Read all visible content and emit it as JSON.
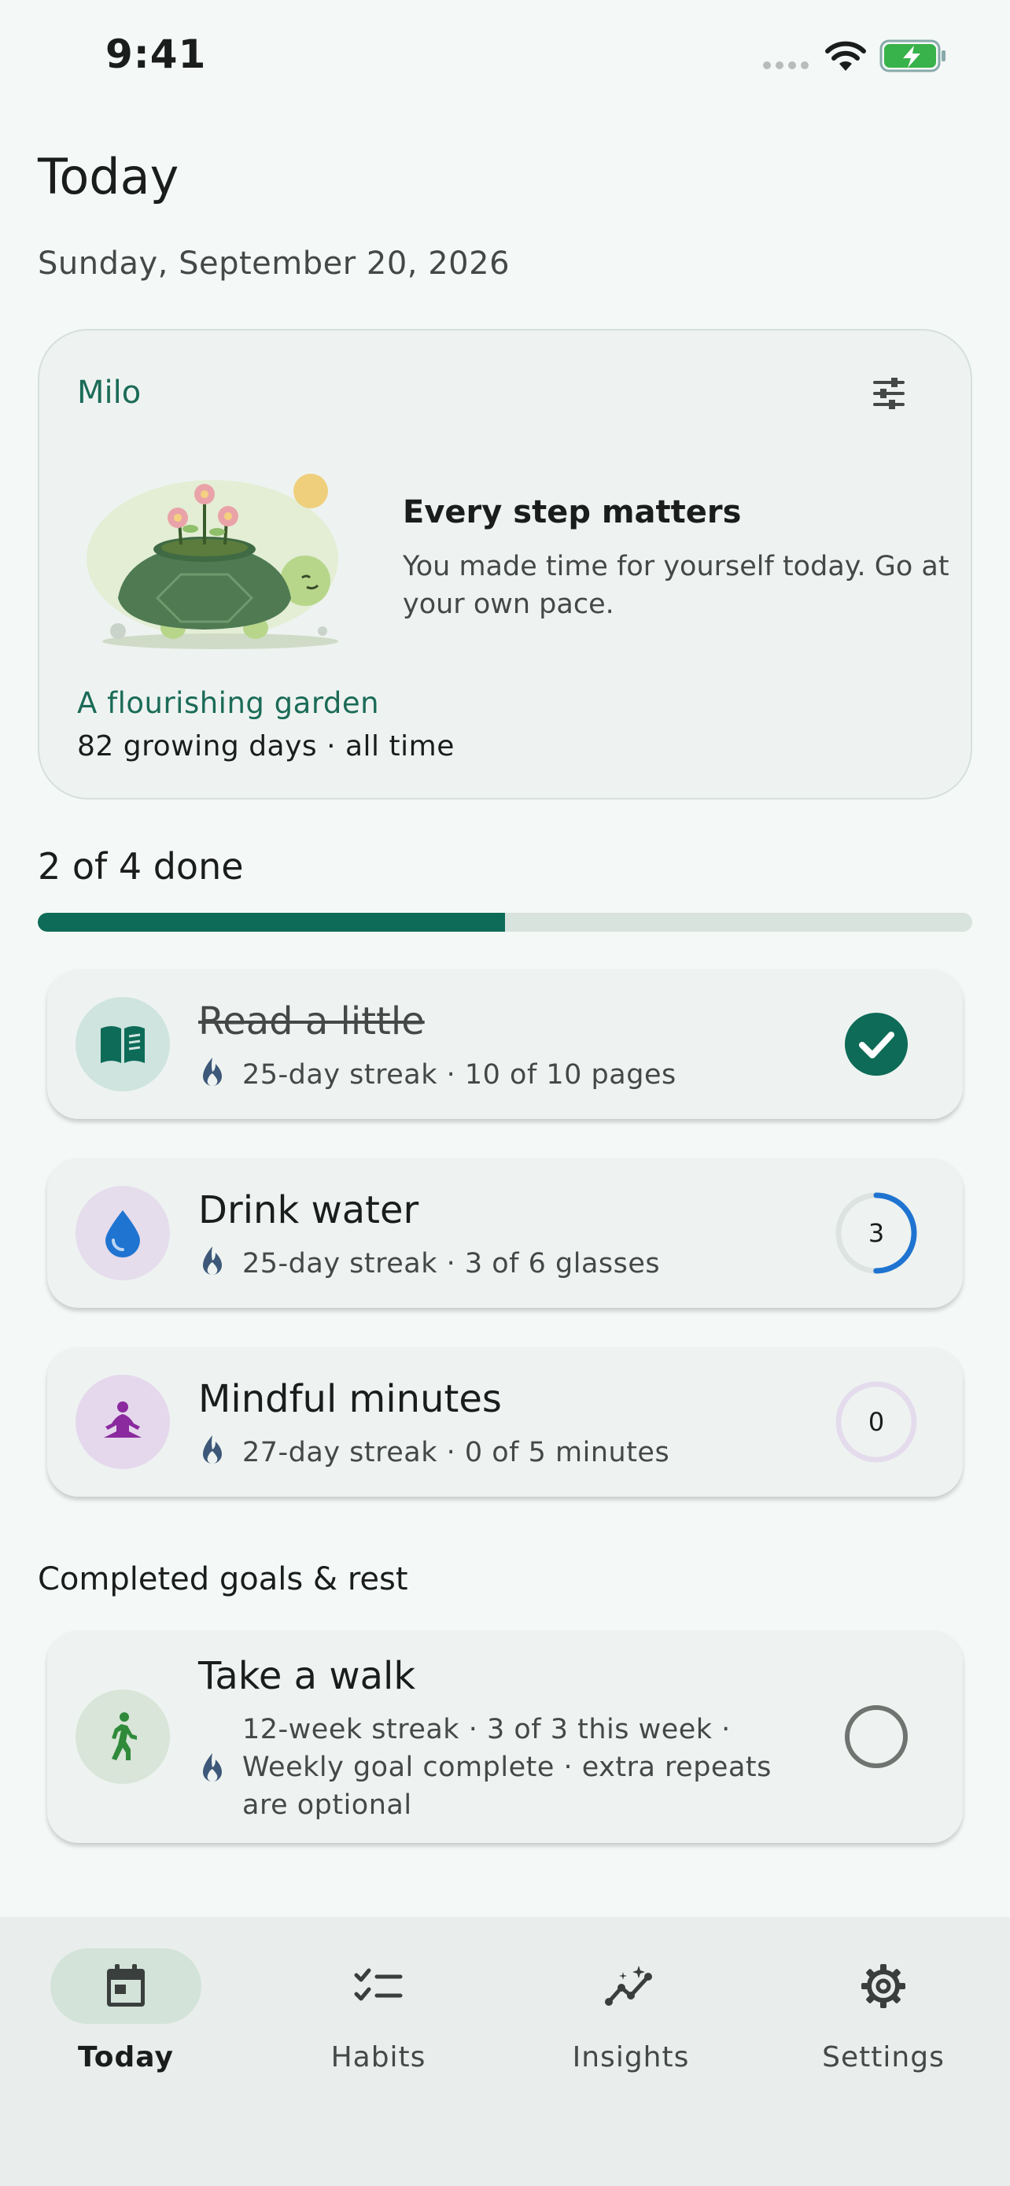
{
  "status": {
    "time": "9:41"
  },
  "header": {
    "title": "Today",
    "date": "Sunday, September 20, 2026"
  },
  "companion": {
    "name": "Milo",
    "headline": "Every step matters",
    "message": "You made time for yourself today. Go at your own pace.",
    "garden_title": "A flourishing garden",
    "garden_subtitle": "82 growing days · all time"
  },
  "progress": {
    "label": "2 of 4 done",
    "done": 2,
    "total": 4
  },
  "habits": [
    {
      "name": "Read a little",
      "meta": "25-day streak · 10 of 10 pages",
      "status": "done",
      "icon": "book-icon"
    },
    {
      "name": "Drink water",
      "meta": "25-day streak · 3 of 6 glasses",
      "count": "3",
      "fraction": 0.5,
      "icon": "water-drop-icon"
    },
    {
      "name": "Mindful minutes",
      "meta": "27-day streak · 0 of 5 minutes",
      "count": "0",
      "fraction": 0,
      "icon": "meditation-icon"
    }
  ],
  "completed_section": {
    "label": "Completed goals & rest",
    "habits": [
      {
        "name": "Take a walk",
        "meta": "12-week streak · 3 of 3 this week · Weekly goal complete · extra repeats are optional",
        "icon": "walking-icon"
      }
    ]
  },
  "nav": {
    "items": [
      {
        "label": "Today",
        "icon": "calendar-icon",
        "active": true
      },
      {
        "label": "Habits",
        "icon": "checklist-icon"
      },
      {
        "label": "Insights",
        "icon": "insights-icon"
      },
      {
        "label": "Settings",
        "icon": "gear-icon"
      }
    ]
  },
  "colors": {
    "accent": "#0d6b57",
    "water": "#1f74d1",
    "mindful": "#8a2a9e",
    "walk": "#2f8a3a"
  }
}
